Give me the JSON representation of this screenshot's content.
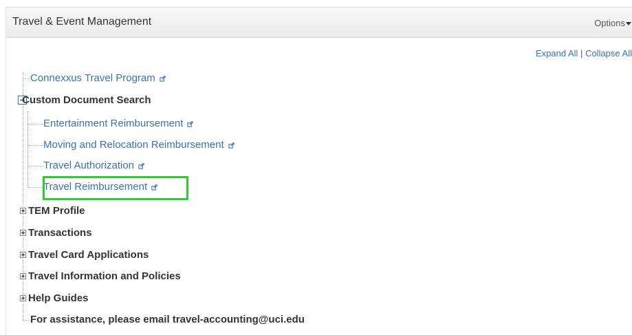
{
  "header": {
    "title": "Travel & Event Management",
    "options_label": "Options"
  },
  "toolbar": {
    "expand_all": "Expand All",
    "separator": "|",
    "collapse_all": "Collapse All"
  },
  "tree": {
    "connexxus": "Connexxus Travel Program",
    "custom_search": {
      "label": "Custom Document Search",
      "children": [
        "Entertainment Reimbursement",
        "Moving and Relocation Reimbursement",
        "Travel Authorization",
        "Travel Reimbursement"
      ]
    },
    "tem_profile": "TEM Profile",
    "transactions": "Transactions",
    "travel_card": "Travel Card Applications",
    "travel_info": "Travel Information and Policies",
    "help_guides": "Help Guides",
    "assistance": "For assistance, please email travel-accounting@uci.edu"
  },
  "highlight_color": "#2ecc2e",
  "link_color": "#3a72b0",
  "icons": {
    "external": "external-link-icon",
    "expand": "expand-plus-icon",
    "collapse": "collapse-minus-icon",
    "options_caret": "caret-down-icon"
  }
}
